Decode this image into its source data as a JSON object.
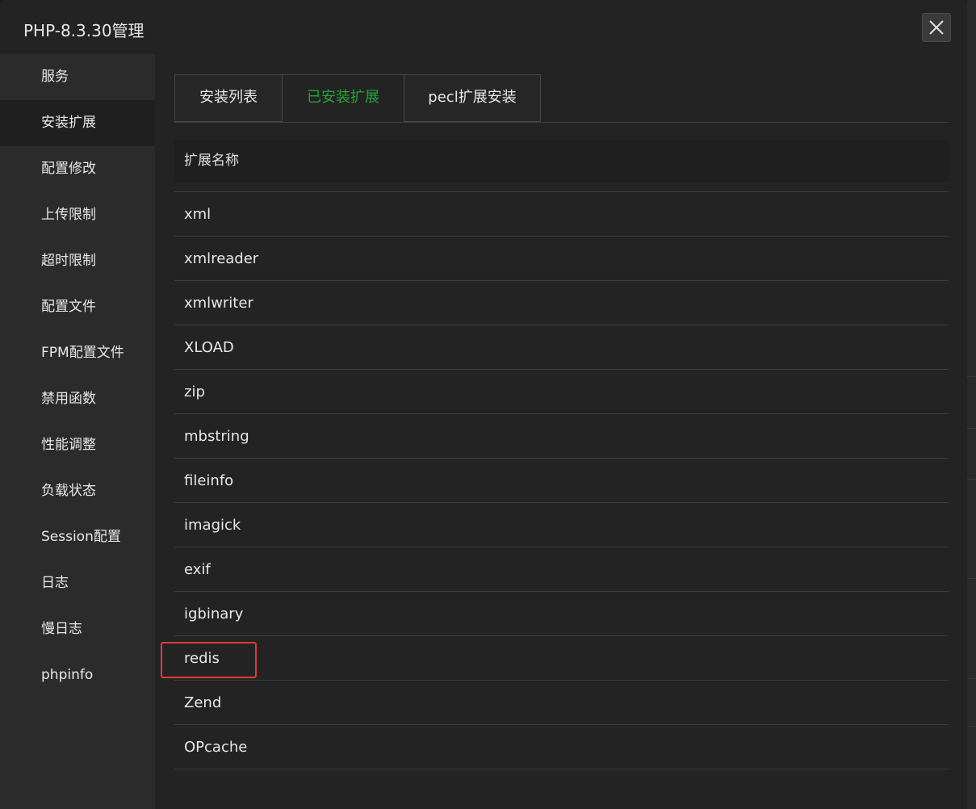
{
  "window": {
    "title": "PHP-8.3.30管理",
    "close_icon": "close-icon"
  },
  "sidebar": {
    "active_index": 1,
    "items": [
      {
        "label": "服务"
      },
      {
        "label": "安装扩展"
      },
      {
        "label": "配置修改"
      },
      {
        "label": "上传限制"
      },
      {
        "label": "超时限制"
      },
      {
        "label": "配置文件"
      },
      {
        "label": "FPM配置文件"
      },
      {
        "label": "禁用函数"
      },
      {
        "label": "性能调整"
      },
      {
        "label": "负载状态"
      },
      {
        "label": "Session配置"
      },
      {
        "label": "日志"
      },
      {
        "label": "慢日志"
      },
      {
        "label": "phpinfo"
      }
    ]
  },
  "tabs": {
    "active_index": 1,
    "items": [
      {
        "label": "安装列表"
      },
      {
        "label": "已安装扩展"
      },
      {
        "label": "pecl扩展安装"
      }
    ]
  },
  "extensions_table": {
    "column_header": "扩展名称",
    "rows": [
      {
        "name": "xml"
      },
      {
        "name": "xmlreader"
      },
      {
        "name": "xmlwriter"
      },
      {
        "name": "XLOAD"
      },
      {
        "name": "zip"
      },
      {
        "name": "mbstring"
      },
      {
        "name": "fileinfo"
      },
      {
        "name": "imagick"
      },
      {
        "name": "exif"
      },
      {
        "name": "igbinary"
      },
      {
        "name": "redis"
      },
      {
        "name": "Zend"
      },
      {
        "name": "OPcache"
      }
    ],
    "highlighted_row": "redis"
  },
  "colors": {
    "accent_green": "#20a53a",
    "highlight_red": "#e53935"
  }
}
